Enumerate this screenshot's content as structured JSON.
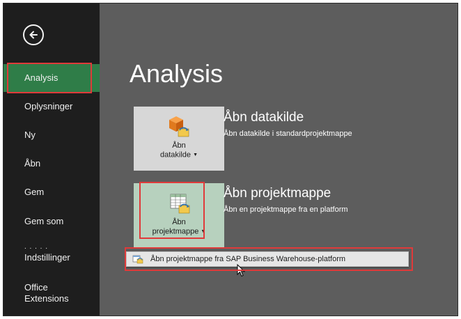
{
  "sidebar": {
    "items": [
      {
        "label": "Analysis",
        "active": true
      },
      {
        "label": "Oplysninger"
      },
      {
        "label": "Ny"
      },
      {
        "label": "Åbn"
      },
      {
        "label": "Gem"
      },
      {
        "label": "Gem som"
      },
      {
        "label": "Indstillinger"
      },
      {
        "label": "Office Extensions"
      }
    ],
    "dots": ". . . . ."
  },
  "main": {
    "title": "Analysis",
    "datasource": {
      "tile_line1": "Åbn",
      "tile_line2": "datakilde",
      "heading": "Åbn datakilde",
      "description": "Åbn datakilde i standardprojektmappe"
    },
    "workbook": {
      "tile_line1": "Åbn",
      "tile_line2": "projektmappe",
      "heading": "Åbn projektmappe",
      "description": "Åbn en projektmappe fra en platform"
    },
    "menu_item": "Åbn projektmappe fra SAP Business Warehouse-platform"
  },
  "colors": {
    "sidebar_bg": "#1e1e1e",
    "active_item": "#2f7d48",
    "main_bg": "#5d5d5d",
    "highlight": "#e03a3a"
  },
  "icons": {
    "back": "back-arrow-icon",
    "datasource": "datasource-cube-icon",
    "workbook": "workbook-grid-icon",
    "menu": "sap-bw-icon",
    "cursor": "mouse-pointer-icon"
  }
}
